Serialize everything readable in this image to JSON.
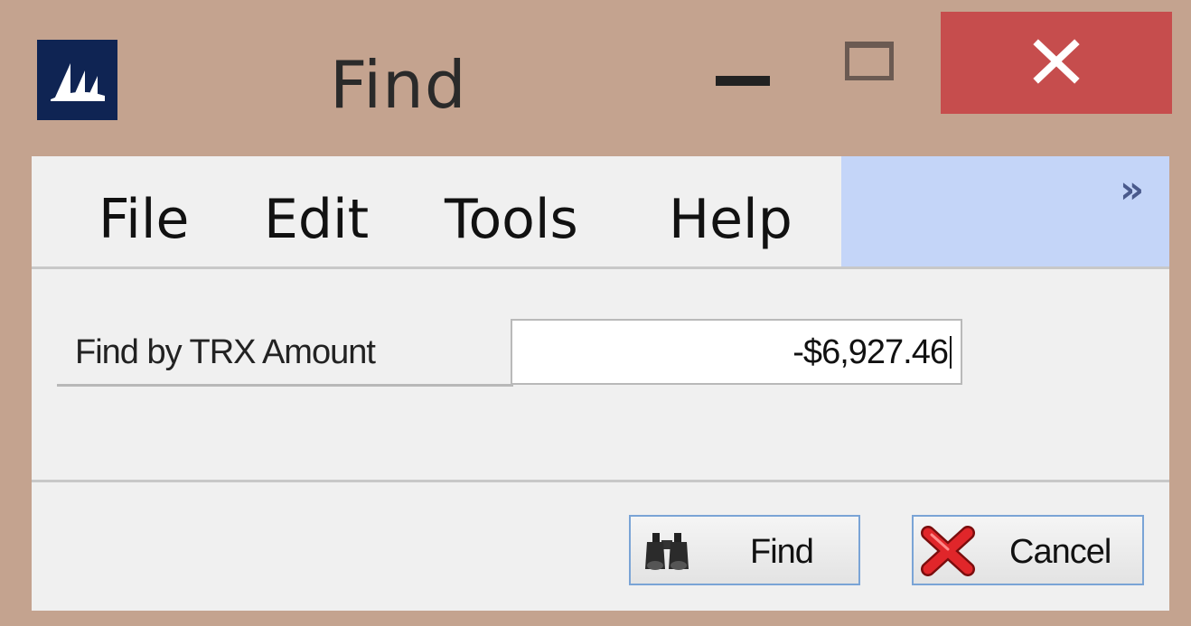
{
  "window": {
    "title": "Find",
    "icon": "dynamics-gp-logo-icon",
    "controls": [
      "minimize-icon",
      "maximize-icon",
      "close-icon"
    ],
    "colors": {
      "frame": "#c4a38f",
      "close": "#c64d4d",
      "menu_highlight": "#c4d5f8"
    }
  },
  "menu": {
    "items": [
      {
        "label": "File"
      },
      {
        "label": "Edit"
      },
      {
        "label": "Tools"
      },
      {
        "label": "Help"
      }
    ],
    "overflow_icon": "chevron-double-right-icon",
    "overflow_glyph": "»"
  },
  "form": {
    "field_label": "Find by TRX Amount",
    "field_value": "-$6,927.46"
  },
  "buttons": {
    "find_label": "Find",
    "find_icon": "binoculars-icon",
    "cancel_label": "Cancel",
    "cancel_icon": "red-x-icon"
  }
}
